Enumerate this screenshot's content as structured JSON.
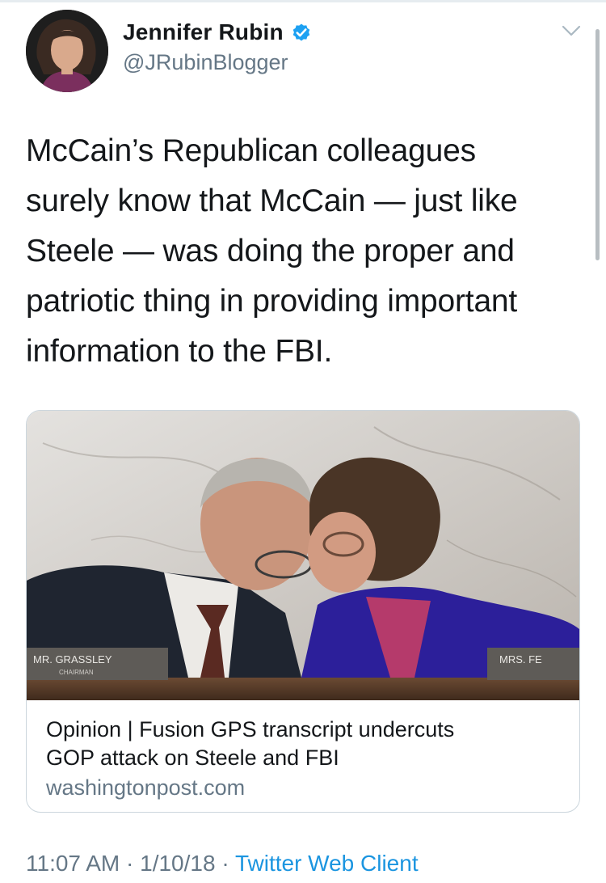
{
  "author": {
    "display_name": "Jennifer Rubin",
    "handle": "@JRubinBlogger",
    "verified": true,
    "verified_icon": "verified-badge-icon",
    "accent_color": "#1da1f2"
  },
  "tweet": {
    "lines": [
      "McCain’s Republican colleagues",
      "surely know that McCain — just like",
      "Steele — was doing the proper and",
      "patriotic thing in providing important",
      "information to the FBI."
    ]
  },
  "card": {
    "title_lines": [
      "Opinion | Fusion GPS transcript undercuts",
      "GOP attack on Steele and FBI"
    ],
    "domain": "washingtonpost.com",
    "photo_nameplates": {
      "left": "MR. GRASSLEY",
      "left_sub": "CHAIRMAN",
      "right": "MRS. FE"
    }
  },
  "meta": {
    "time": "11:07 AM",
    "separator": " · ",
    "date": "1/10/18",
    "client": "Twitter Web Client",
    "link_color": "#1b95e0"
  }
}
